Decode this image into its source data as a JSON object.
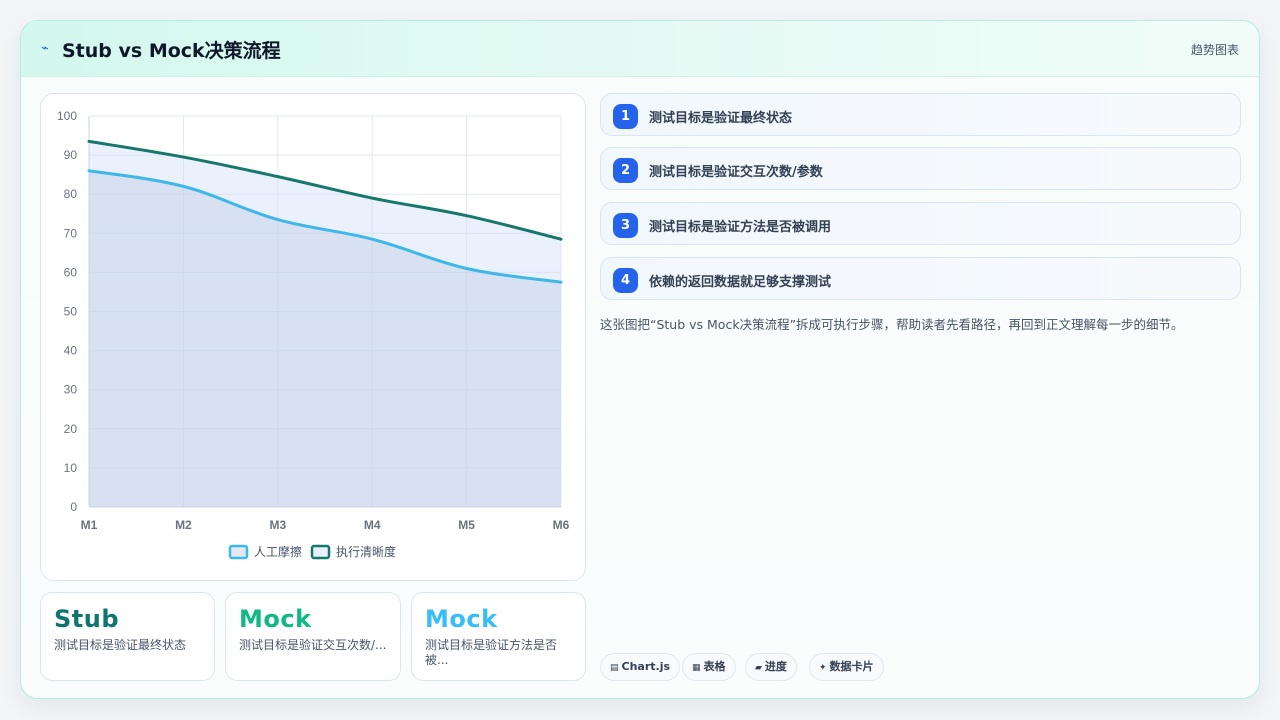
{
  "header": {
    "title": "Stub vs Mock决策流程",
    "right_label": "趋势图表",
    "icon": "lightning-icon"
  },
  "chart_data": {
    "type": "area",
    "categories": [
      "M1",
      "M2",
      "M3",
      "M4",
      "M5",
      "M6"
    ],
    "ylim": [
      0,
      100
    ],
    "yticks": [
      0,
      10,
      20,
      30,
      40,
      50,
      60,
      70,
      80,
      90,
      100
    ],
    "grid": true,
    "legend_position": "bottom",
    "series": [
      {
        "name": "人工摩擦",
        "values": [
          86,
          82,
          73.5,
          68.5,
          61,
          57.5
        ],
        "color": "#3fb8e8",
        "fill": "rgba(190,206,226,0.45)"
      },
      {
        "name": "执行清晰度",
        "values": [
          93.5,
          89.5,
          84.5,
          79,
          74.5,
          68.5
        ],
        "color": "#17776b",
        "fill": "rgba(210,222,250,0.45)"
      }
    ]
  },
  "mini_cards": [
    {
      "title": "Stub",
      "text": "测试目标是验证最终状态",
      "color": "#0f766e"
    },
    {
      "title": "Mock",
      "text": "测试目标是验证交互次数/...",
      "color": "#10b981"
    },
    {
      "title": "Mock",
      "text": "测试目标是验证方法是否被...",
      "color": "#38bdf8"
    }
  ],
  "steps": [
    {
      "num": "1",
      "label": "测试目标是验证最终状态"
    },
    {
      "num": "2",
      "label": "测试目标是验证交互次数/参数"
    },
    {
      "num": "3",
      "label": "测试目标是验证方法是否被调用"
    },
    {
      "num": "4",
      "label": "依赖的返回数据就足够支撑测试"
    }
  ],
  "description": "这张图把“Stub vs Mock决策流程”拆成可执行步骤，帮助读者先看路径，再回到正文理解每一步的细节。",
  "chips": [
    {
      "icon": "▤",
      "label": "Chart.js"
    },
    {
      "icon": "▦",
      "label": "表格"
    },
    {
      "icon": "▰",
      "label": "进度"
    },
    {
      "icon": "✦",
      "label": "数据卡片"
    }
  ]
}
